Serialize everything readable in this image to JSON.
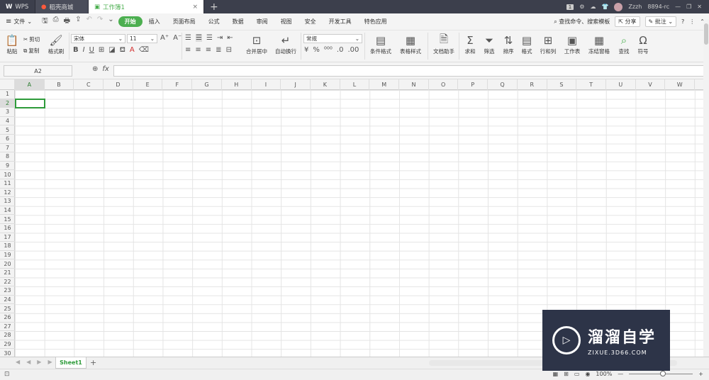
{
  "titlebar": {
    "tabs": [
      {
        "label": "WPS"
      },
      {
        "label": "稻壳商城"
      },
      {
        "label": "工作簿1"
      }
    ],
    "user": "Zzzh",
    "account": "8894-rc",
    "badge": "1"
  },
  "menubar": {
    "file_label": "文件",
    "tabs": [
      "开始",
      "插入",
      "页面布局",
      "公式",
      "数据",
      "审阅",
      "视图",
      "安全",
      "开发工具",
      "特色应用"
    ],
    "search": "查找命令、搜索模板",
    "share": "分享",
    "comment": "批注"
  },
  "ribbon": {
    "paste": "粘贴",
    "cut": "剪切",
    "copy": "复制",
    "format_painter": "格式刷",
    "font_name": "宋体",
    "font_size": "11",
    "bold": "B",
    "italic": "I",
    "underline": "U",
    "merge_center": "合并居中",
    "wrap_text": "自动换行",
    "number_format": "常规",
    "cond_format": "条件格式",
    "table_style": "表格样式",
    "doc_helper": "文档助手",
    "sum": "求和",
    "filter": "筛选",
    "sort": "排序",
    "format": "格式",
    "rows_cols": "行和列",
    "worksheet": "工作表",
    "freeze": "冻结窗格",
    "find": "查找",
    "symbol": "符号"
  },
  "formulabar": {
    "name_box": "A2",
    "fx": "fx"
  },
  "grid": {
    "columns": [
      "A",
      "B",
      "C",
      "D",
      "E",
      "F",
      "G",
      "H",
      "I",
      "J",
      "K",
      "L",
      "M",
      "N",
      "O",
      "P",
      "Q",
      "R",
      "S",
      "T",
      "U",
      "V",
      "W"
    ],
    "rows": [
      "1",
      "2",
      "3",
      "4",
      "5",
      "6",
      "7",
      "8",
      "9",
      "10",
      "11",
      "12",
      "13",
      "14",
      "15",
      "16",
      "17",
      "18",
      "19",
      "20",
      "21",
      "22",
      "23",
      "24",
      "25",
      "26",
      "27",
      "28",
      "29",
      "30"
    ]
  },
  "sheets": {
    "active": "Sheet1"
  },
  "status": {
    "zoom": "100%"
  },
  "watermark": {
    "title": "溜溜自学",
    "url": "ZIXUE.3D66.COM"
  },
  "colors": {
    "accent": "#4caf50",
    "titlebar": "#3c3f4c",
    "selection": "#2e9b3a"
  }
}
